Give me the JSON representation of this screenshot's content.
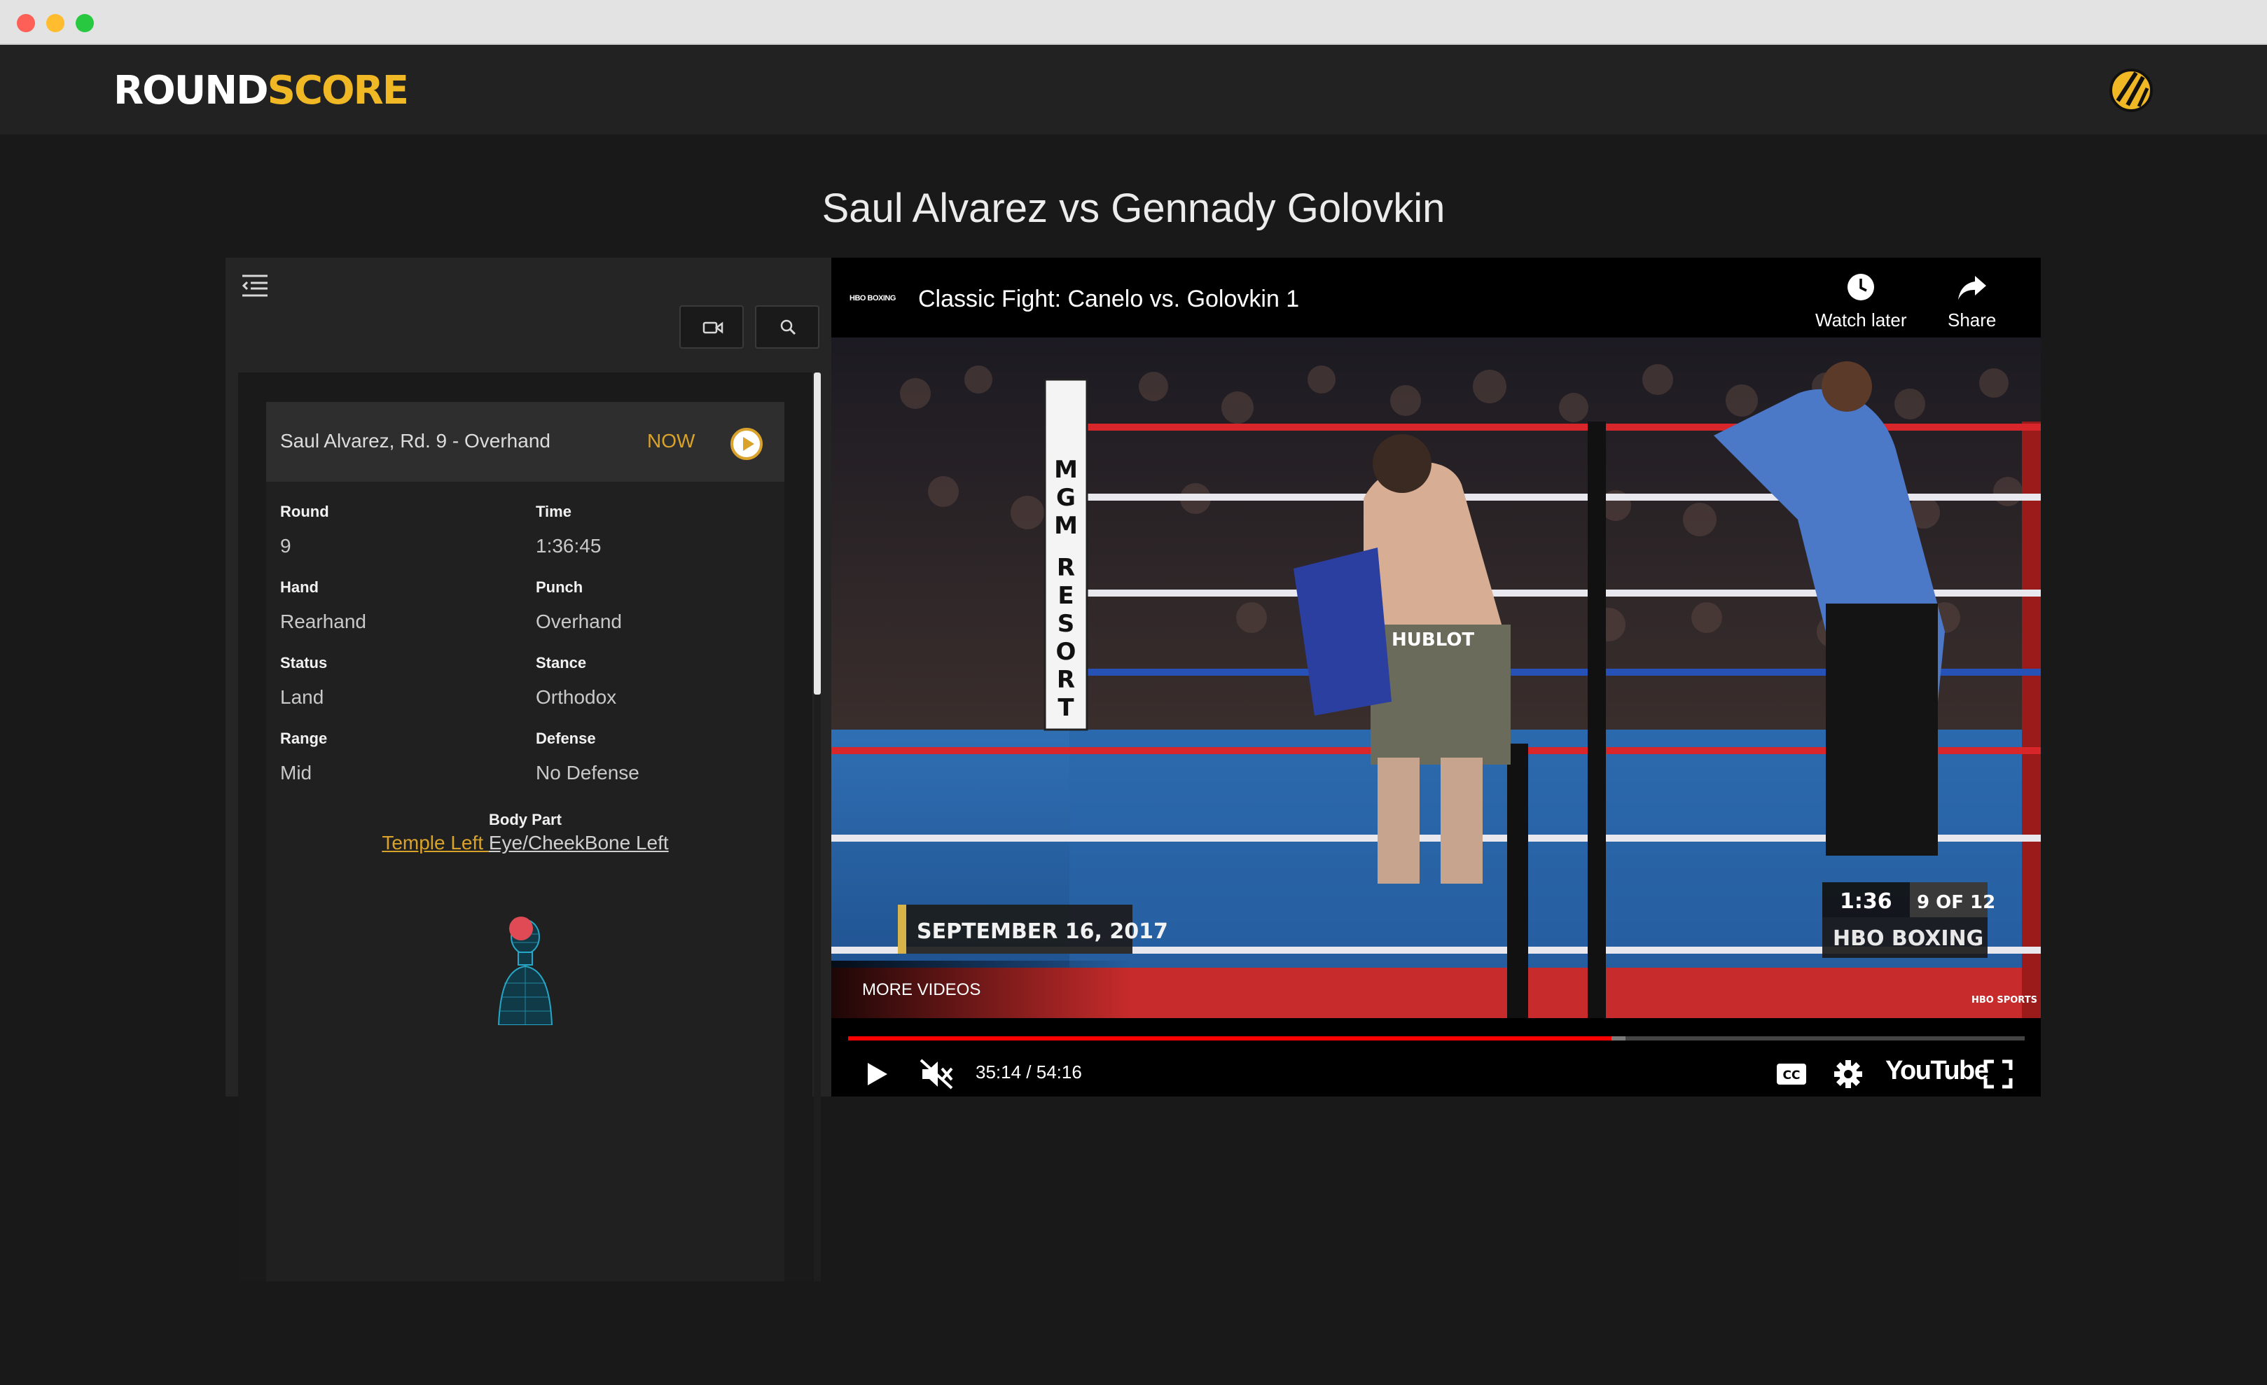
{
  "app": {
    "logo_part1": "ROUND",
    "logo_part2": "SCORE",
    "accent_color": "#f0b824"
  },
  "page": {
    "title": "Saul Alvarez vs Gennady Golovkin"
  },
  "sidebar": {
    "menu_icon": "menu-collapse-icon",
    "tools": [
      {
        "icon": "video-camera-icon"
      },
      {
        "icon": "search-icon"
      }
    ],
    "event": {
      "title": "Saul Alvarez, Rd. 9 - Overhand",
      "now_label": "NOW",
      "play_icon": "play-circle-icon",
      "fields": {
        "round_label": "Round",
        "round_value": "9",
        "time_label": "Time",
        "time_value": "1:36:45",
        "hand_label": "Hand",
        "hand_value": "Rearhand",
        "punch_label": "Punch",
        "punch_value": "Overhand",
        "status_label": "Status",
        "status_value": "Land",
        "stance_label": "Stance",
        "stance_value": "Orthodox",
        "range_label": "Range",
        "range_value": "Mid",
        "defense_label": "Defense",
        "defense_value": "No Defense"
      },
      "body_part_label": "Body Part",
      "body_parts": [
        "Temple Left ",
        "Eye/CheekBone Left"
      ],
      "figure_icon": "body-figure-icon"
    }
  },
  "video": {
    "channel": "HBO BOXING",
    "title": "Classic Fight: Canelo vs. Golovkin 1",
    "watch_later_label": "Watch later",
    "share_label": "Share",
    "more_videos_label": "MORE VIDEOS",
    "current_time": "35:14",
    "duration": "54:16",
    "time_display": "35:14 / 54:16",
    "progress_fraction": 0.649,
    "buffer_fraction": 0.661,
    "youtube_label": "YouTube",
    "overlay": {
      "date_banner": "SEPTEMBER 16, 2017",
      "clock": "1:36",
      "round_of": "9 OF 12",
      "network": "HBO BOXING",
      "corner_logo": "HBO SPORTS"
    }
  }
}
